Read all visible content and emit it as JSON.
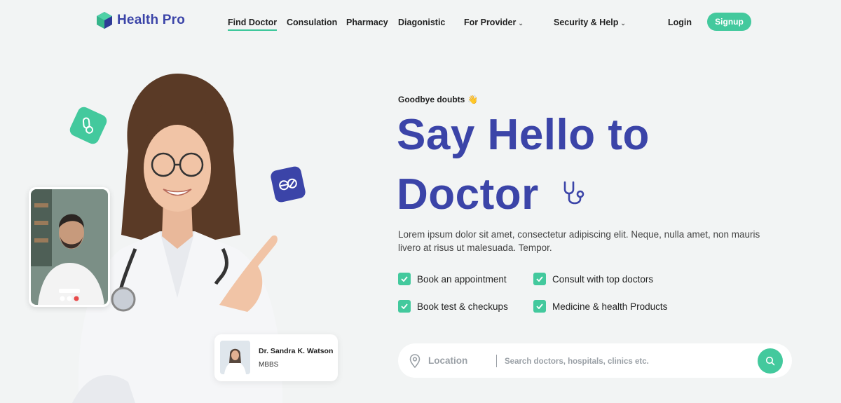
{
  "brand": {
    "name": "Health Pro",
    "icon": "hexagon-cube-logo",
    "colors": {
      "primary": "#3b44a8",
      "accent": "#43c99d"
    }
  },
  "nav": {
    "items": [
      {
        "label": "Find Doctor",
        "active": true
      },
      {
        "label": "Consulation"
      },
      {
        "label": "Pharmacy"
      },
      {
        "label": "Diagonistic"
      },
      {
        "label": "For Provider",
        "dropdown": true
      },
      {
        "label": "Security & Help",
        "dropdown": true
      }
    ],
    "login": "Login",
    "signup": "Signup"
  },
  "hero": {
    "tagline": "Goodbye doubts",
    "tagline_icon": "waving-hand-icon",
    "title_line1": "Say Hello to",
    "title_line2": "Doctor",
    "title_icon": "stethoscope-icon",
    "description": "Lorem ipsum dolor sit amet, consectetur adipiscing elit. Neque, nulla amet, non mauris livero at risus ut malesuada. Tempor.",
    "features": [
      "Book an appointment",
      "Consult with top doctors",
      "Book test & checkups",
      "Medicine & health Products"
    ]
  },
  "doctor_card": {
    "name": "Dr. Sandra K. Watson",
    "degree": "MBBS"
  },
  "search": {
    "location_label": "Location",
    "placeholder": "Search doctors, hospitals, clinics etc.",
    "value": ""
  }
}
